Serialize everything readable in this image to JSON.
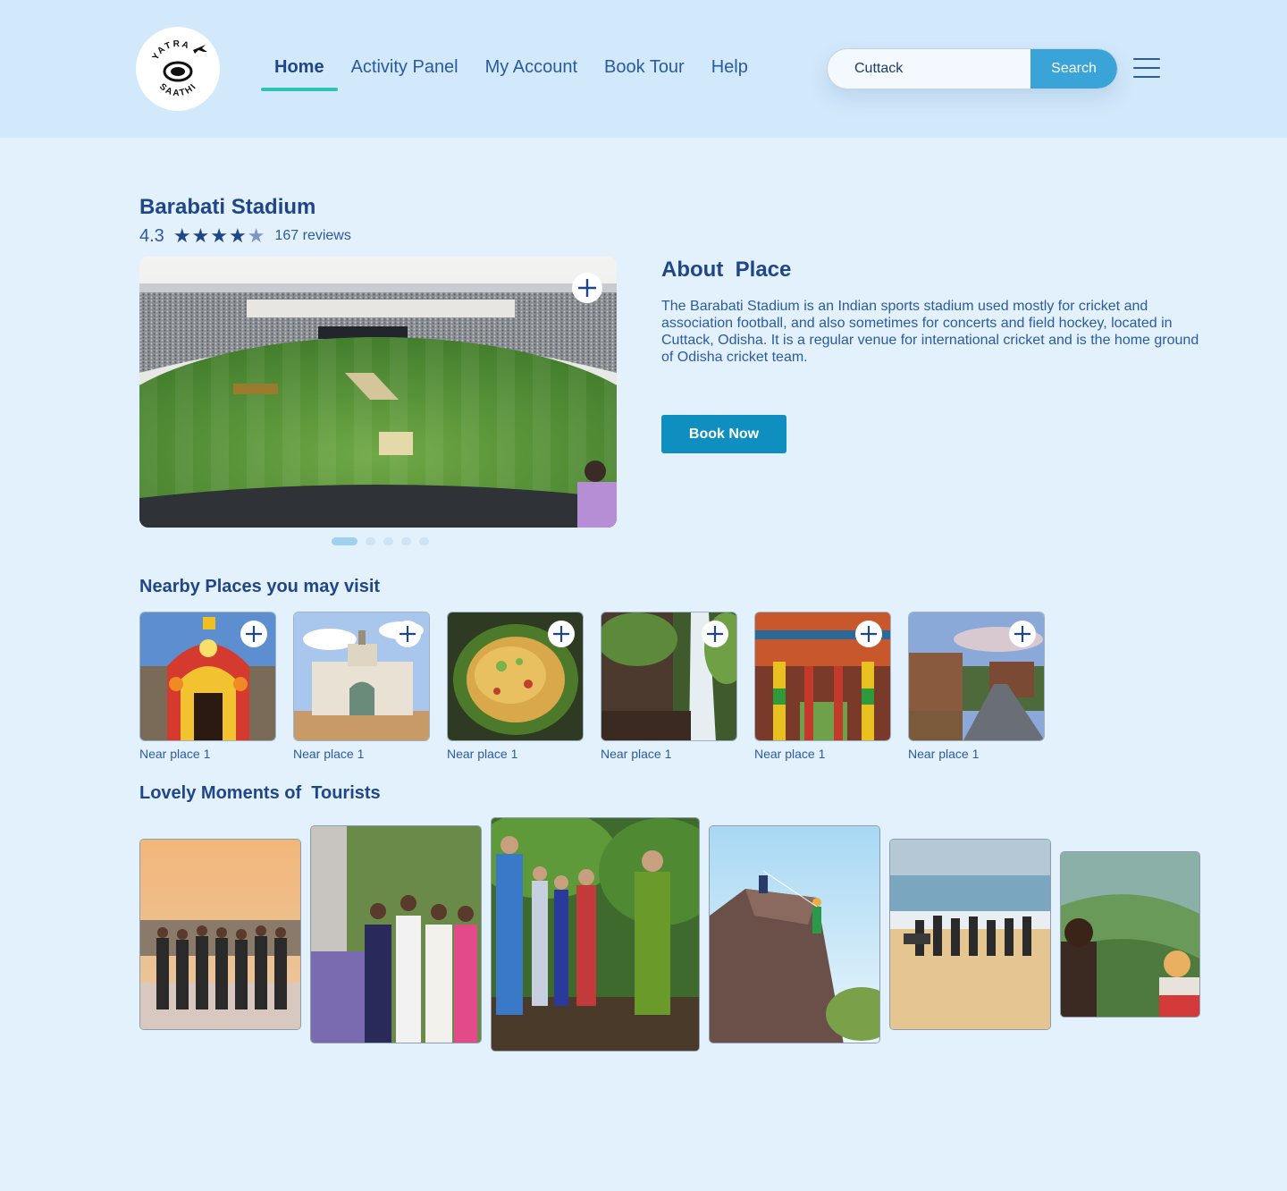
{
  "header": {
    "logo_text_top": "YATRA",
    "logo_text_bottom": "SAATHI",
    "nav": [
      {
        "label": "Home",
        "active": true
      },
      {
        "label": "Activity Panel",
        "active": false
      },
      {
        "label": "My Account",
        "active": false
      },
      {
        "label": "Book Tour",
        "active": false
      },
      {
        "label": "Help",
        "active": false
      }
    ],
    "search_value": "Cuttack",
    "search_button": "Search",
    "menu_icon": "hamburger-menu-icon"
  },
  "place": {
    "title": "Barabati Stadium",
    "rating": "4.3",
    "stars": 4.5,
    "reviews": "167 reviews",
    "carousel_slides": 5,
    "carousel_active": 0
  },
  "about": {
    "title": "About  Place",
    "text": "The Barabati Stadium is an Indian sports stadium used mostly for cricket and association football, and also sometimes for concerts and field hockey, located in Cuttack, Odisha. It is a regular venue for international cricket and is the home ground of Odisha cricket team.",
    "button": "Book Now"
  },
  "nearby": {
    "title": "Nearby Places you may visit",
    "items": [
      {
        "label": "Near place 1"
      },
      {
        "label": "Near place 1"
      },
      {
        "label": "Near place 1"
      },
      {
        "label": "Near place 1"
      },
      {
        "label": "Near place 1"
      },
      {
        "label": "Near place 1"
      }
    ]
  },
  "moments": {
    "title": "Lovely Moments of  Tourists",
    "photo_count": 6
  },
  "colors": {
    "page_bg": "#e3f1fd",
    "header_bg": "#d2e8fb",
    "text_primary": "#20468a",
    "active_underline": "#2fc3b7",
    "search_button": "#3aa4d9",
    "book_button": "#0f8fc0"
  }
}
